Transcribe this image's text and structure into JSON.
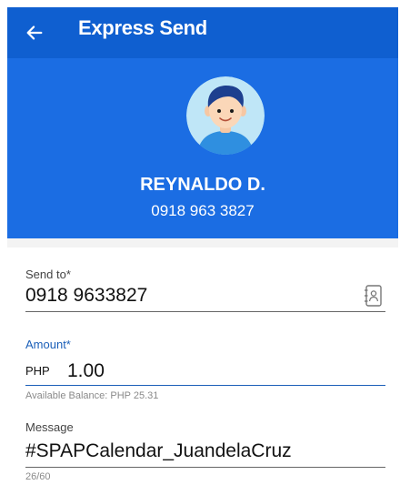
{
  "header": {
    "title": "Express Send",
    "back_icon": "arrow-left-icon"
  },
  "recipient": {
    "name": "REYNALDO D.",
    "number": "0918 963 3827",
    "avatar_icon": "user-avatar-icon"
  },
  "form": {
    "send_to": {
      "label": "Send to*",
      "value": "0918 9633827",
      "icon": "contact-book-icon"
    },
    "amount": {
      "label": "Amount*",
      "currency": "PHP",
      "value": "1.00",
      "helper": "Available Balance: PHP 25.31"
    },
    "message": {
      "label": "Message",
      "value": "#SPAPCalendar_JuandelaCruz",
      "counter": "26/60"
    }
  },
  "colors": {
    "header_bg": "#0f5fd0",
    "profile_bg": "#1b6de3",
    "accent": "#1b5fb8"
  }
}
